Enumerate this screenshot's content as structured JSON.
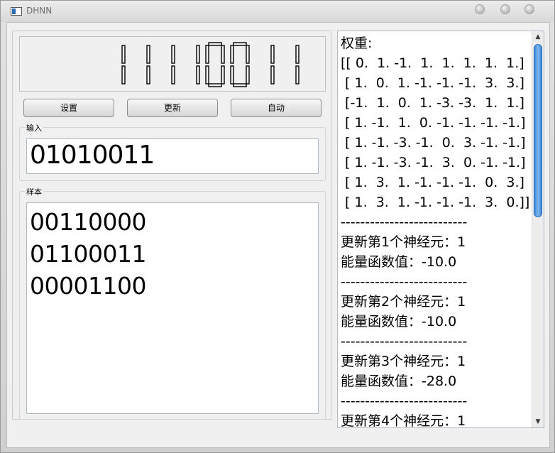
{
  "window": {
    "title": "DHNN"
  },
  "display": {
    "digits": "11110011"
  },
  "buttons": {
    "settings": "设置",
    "update": "更新",
    "auto": "自动"
  },
  "input_group": {
    "label": "输入",
    "value": "01010011"
  },
  "samples_group": {
    "label": "样本",
    "lines": [
      "00110000",
      "01100011",
      "00001100"
    ]
  },
  "log": {
    "lines": [
      "权重:",
      "[[ 0.  1. -1.  1.  1.  1.  1.  1.]",
      " [ 1.  0.  1. -1. -1. -1.  3.  3.]",
      " [-1.  1.  0.  1. -3. -3.  1.  1.]",
      " [ 1. -1.  1.  0. -1. -1. -1. -1.]",
      " [ 1. -1. -3. -1.  0.  3. -1. -1.]",
      " [ 1. -1. -3. -1.  3.  0. -1. -1.]",
      " [ 1.  3.  1. -1. -1. -1.  0.  3.]",
      " [ 1.  3.  1. -1. -1. -1.  3.  0.]]",
      "--------------------------",
      "更新第1个神经元：1",
      "能量函数值：-10.0",
      "--------------------------",
      "更新第2个神经元：1",
      "能量函数值：-10.0",
      "--------------------------",
      "更新第3个神经元：1",
      "能量函数值：-28.0",
      "--------------------------",
      "更新第4个神经元：1"
    ]
  },
  "colors": {
    "lcd_segment": "#000000",
    "scroll_thumb": "#3a86d6"
  }
}
